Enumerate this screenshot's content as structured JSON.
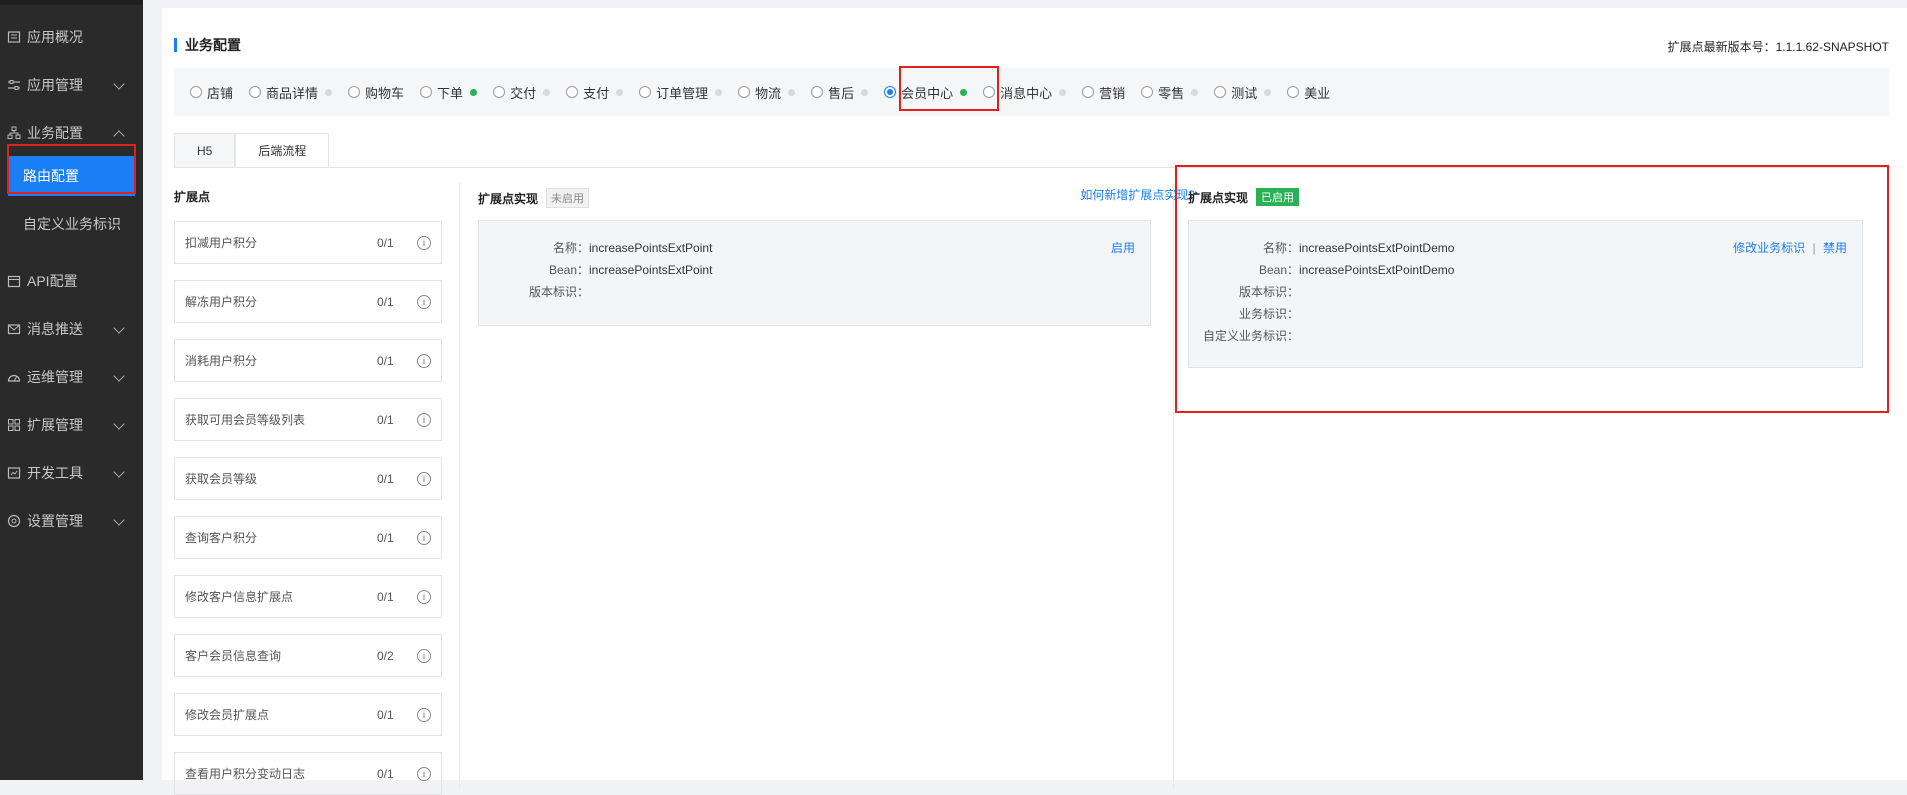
{
  "sidebar": {
    "items": [
      {
        "label": "应用概况",
        "icon": "dashboard-icon"
      },
      {
        "label": "应用管理",
        "icon": "sliders-icon"
      },
      {
        "label": "业务配置",
        "icon": "org-icon"
      },
      {
        "label": "API配置",
        "icon": "calendar-icon"
      },
      {
        "label": "消息推送",
        "icon": "mail-icon"
      },
      {
        "label": "运维管理",
        "icon": "gauge-icon"
      },
      {
        "label": "扩展管理",
        "icon": "grid-icon"
      },
      {
        "label": "开发工具",
        "icon": "tool-icon"
      },
      {
        "label": "设置管理",
        "icon": "gear-icon"
      }
    ],
    "sub_items": [
      {
        "label": "路由配置",
        "active": true
      },
      {
        "label": "自定义业务标识",
        "active": false
      }
    ]
  },
  "header": {
    "title": "业务配置",
    "version_label": "扩展点最新版本号：1.1.1.62-SNAPSHOT"
  },
  "domains": [
    {
      "label": "店铺",
      "checked": false,
      "dot": "none"
    },
    {
      "label": "商品详情",
      "checked": false,
      "dot": "gray"
    },
    {
      "label": "购物车",
      "checked": false,
      "dot": "none"
    },
    {
      "label": "下单",
      "checked": false,
      "dot": "green"
    },
    {
      "label": "交付",
      "checked": false,
      "dot": "gray"
    },
    {
      "label": "支付",
      "checked": false,
      "dot": "gray"
    },
    {
      "label": "订单管理",
      "checked": false,
      "dot": "gray"
    },
    {
      "label": "物流",
      "checked": false,
      "dot": "gray"
    },
    {
      "label": "售后",
      "checked": false,
      "dot": "gray"
    },
    {
      "label": "会员中心",
      "checked": true,
      "dot": "green"
    },
    {
      "label": "消息中心",
      "checked": false,
      "dot": "gray"
    },
    {
      "label": "营销",
      "checked": false,
      "dot": "none"
    },
    {
      "label": "零售",
      "checked": false,
      "dot": "gray"
    },
    {
      "label": "测试",
      "checked": false,
      "dot": "gray"
    },
    {
      "label": "美业",
      "checked": false,
      "dot": "none"
    }
  ],
  "tabs": [
    {
      "label": "H5",
      "active": false
    },
    {
      "label": "后端流程",
      "active": true
    }
  ],
  "ext_points": {
    "title": "扩展点",
    "items": [
      {
        "name": "扣减用户积分",
        "count": "0/1"
      },
      {
        "name": "解冻用户积分",
        "count": "0/1"
      },
      {
        "name": "消耗用户积分",
        "count": "0/1"
      },
      {
        "name": "获取可用会员等级列表",
        "count": "0/1"
      },
      {
        "name": "获取会员等级",
        "count": "0/1"
      },
      {
        "name": "查询客户积分",
        "count": "0/1"
      },
      {
        "name": "修改客户信息扩展点",
        "count": "0/1"
      },
      {
        "name": "客户会员信息查询",
        "count": "0/2"
      },
      {
        "name": "修改会员扩展点",
        "count": "0/1"
      },
      {
        "name": "查看用户积分变动日志",
        "count": "0/1"
      }
    ],
    "info_glyph": "i"
  },
  "impl_disabled": {
    "title": "扩展点实现",
    "status": "未启用",
    "help_link": "如何新增扩展点实现?",
    "name_label": "名称：",
    "name_value": "increasePointsExtPoint",
    "bean_label": "Bean：",
    "bean_value": "increasePointsExtPoint",
    "version_label": "版本标识：",
    "action": "启用"
  },
  "impl_enabled": {
    "title": "扩展点实现",
    "status": "已启用",
    "name_label": "名称：",
    "name_value": "increasePointsExtPointDemo",
    "bean_label": "Bean：",
    "bean_value": "increasePointsExtPointDemo",
    "version_label": "版本标识：",
    "biz_label": "业务标识：",
    "custom_label": "自定义业务标识：",
    "action_edit": "修改业务标识",
    "separator": "|",
    "action_disable": "禁用"
  },
  "colors": {
    "accent": "#1a7ef5",
    "success": "#2ab155",
    "highlight": "#e0201c",
    "sidebar_bg": "#2a2a2a"
  }
}
